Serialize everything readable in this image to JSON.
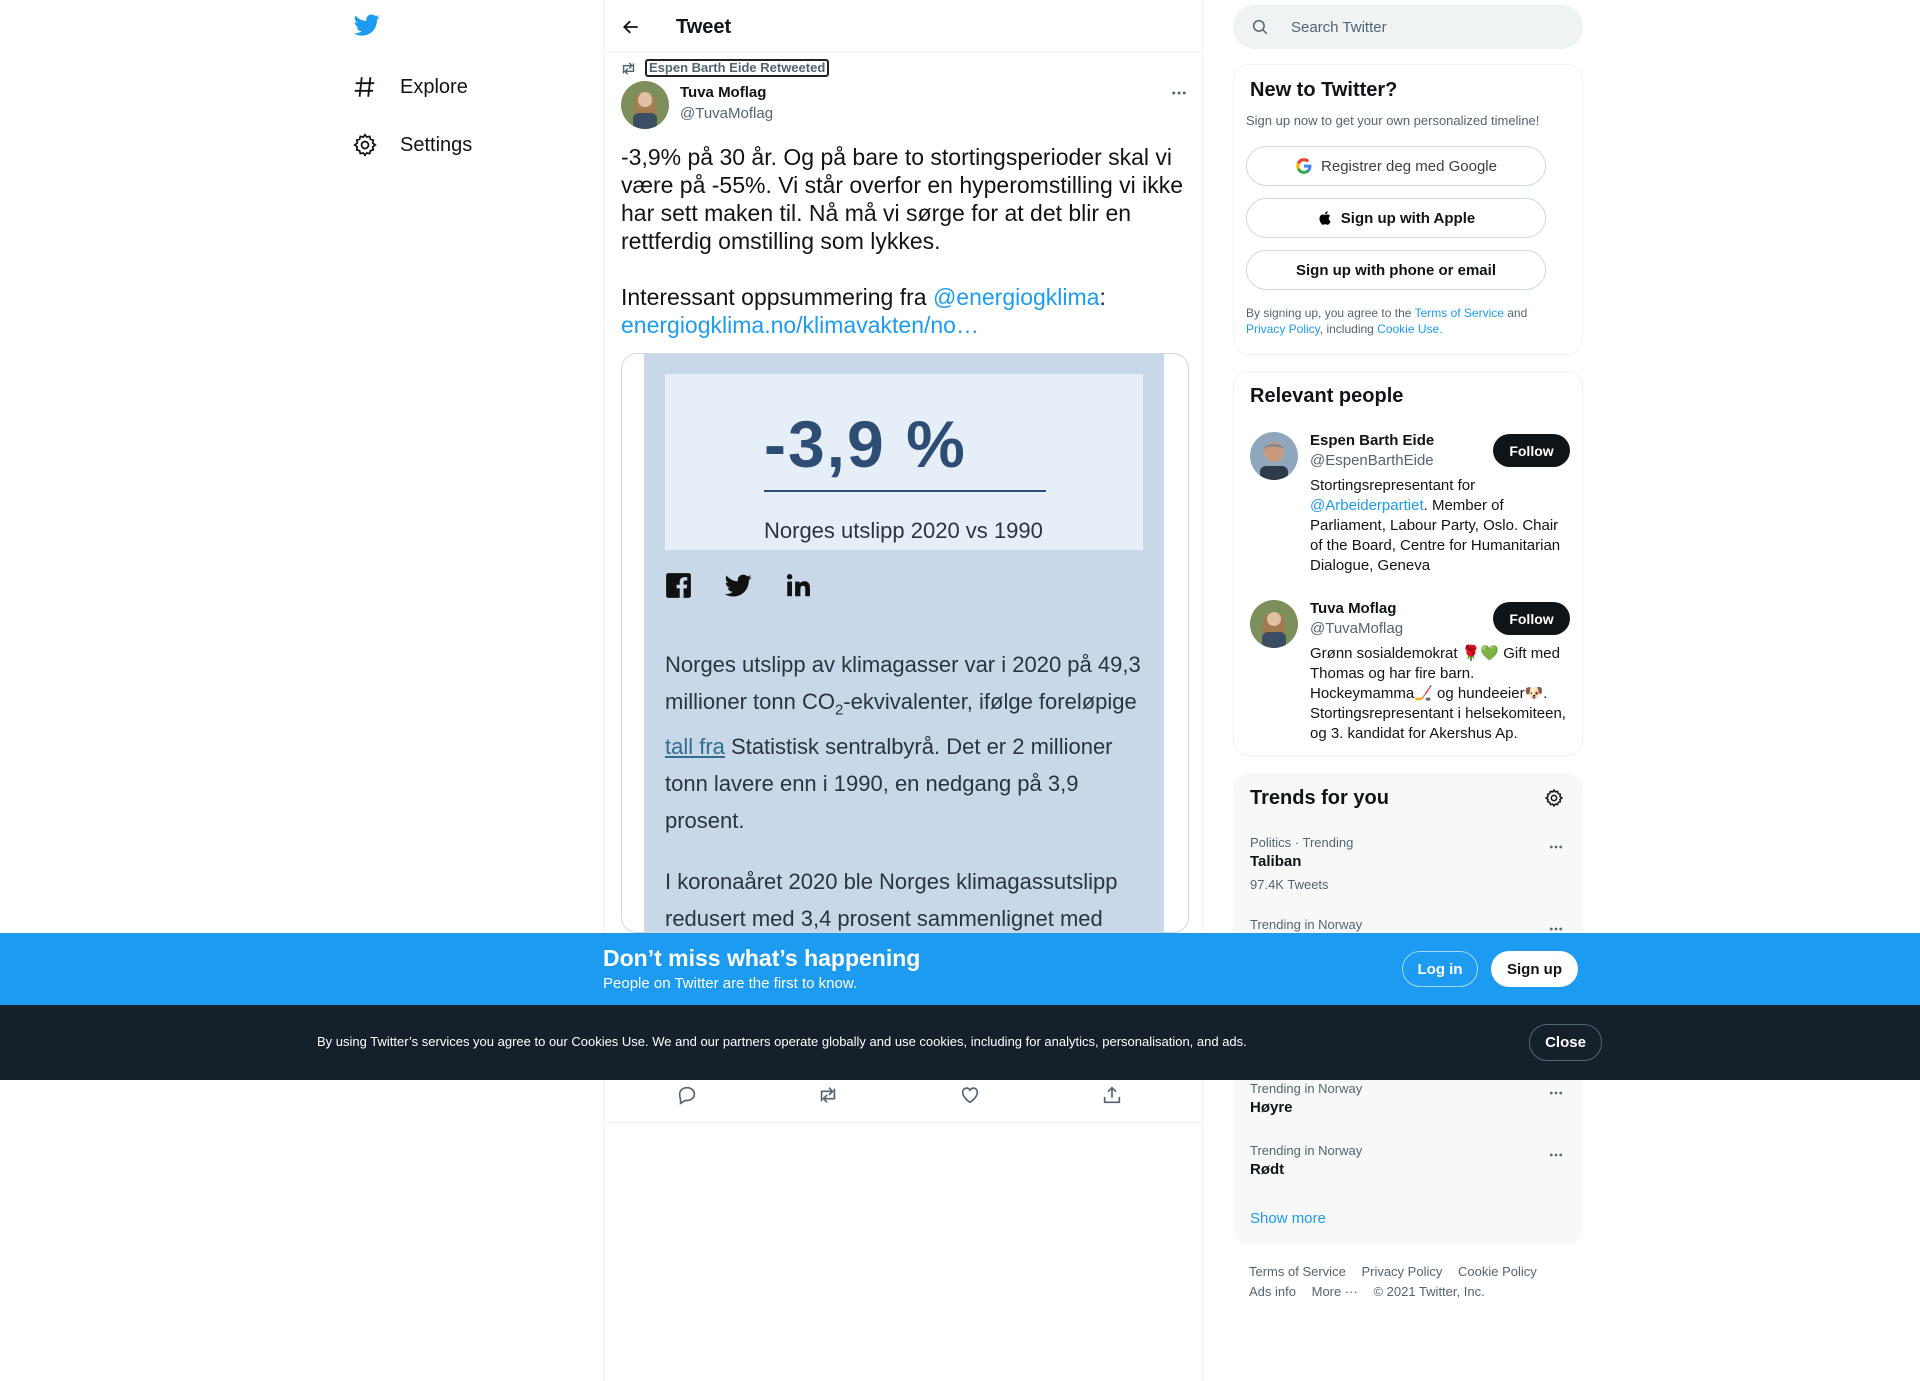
{
  "colors": {
    "accent": "#1d9bf0",
    "text": "#0f1419",
    "muted": "#536471",
    "banner": "#1d9bf0",
    "cookie_bar": "#15202b"
  },
  "nav": {
    "logo_icon": "twitter-bird-icon",
    "items": [
      {
        "label": "Explore",
        "icon": "hash-icon"
      },
      {
        "label": "Settings",
        "icon": "gear-icon"
      }
    ]
  },
  "header": {
    "title": "Tweet",
    "back_icon": "arrow-left-icon"
  },
  "tweet": {
    "retweeted_by": "Espen Barth Eide Retweeted",
    "author_name": "Tuva Moflag",
    "author_handle": "@TuvaMoflag",
    "text_p1": "-3,9% på 30 år. Og på bare to stortingsperioder skal vi være på -55%. Vi står overfor en hyperomstilling vi ikke har sett maken til. Nå må vi sørge for at det blir en rettferdig omstilling som lykkes.",
    "text_p2_prefix": "Interessant oppsummering fra ",
    "mention": "@energiogklima",
    "text_p2_colon": ":",
    "url": "energiogklima.no/klimavakten/no…",
    "media": {
      "stat_value": "-3,9  %",
      "stat_caption": "Norges utslipp 2020 vs 1990",
      "share_icons": [
        "facebook-icon",
        "twitter-icon",
        "linkedin-icon"
      ],
      "para1_a": "Norges utslipp av klimagasser var i 2020 på 49,3 millioner tonn CO",
      "para1_sub": "2",
      "para1_b": "-ekvivalenter, ifølge foreløpige ",
      "para1_link": "tall fra",
      "para1_c": " Statistisk sentralbyrå. Det er 2 millioner tonn lavere enn i 1990, en nedgang på 3,9 prosent.",
      "para2": "I koronaåret 2020 ble Norges klimagassutslipp redusert med 3,4 prosent sammenlignet med"
    },
    "actions": [
      "reply-icon",
      "retweet-icon",
      "like-icon",
      "share-icon"
    ]
  },
  "search": {
    "placeholder": "Search Twitter"
  },
  "new_to_twitter": {
    "title": "New to Twitter?",
    "subtitle": "Sign up now to get your own personalized timeline!",
    "google_btn": "Registrer deg med Google",
    "apple_btn": "Sign up with Apple",
    "phone_btn": "Sign up with phone or email",
    "legal_a": "By signing up, you agree to the ",
    "terms": "Terms of Service",
    "legal_b": " and ",
    "privacy": "Privacy Policy",
    "legal_c": ", including ",
    "cookie": "Cookie Use",
    "legal_d": "."
  },
  "relevant": {
    "title": "Relevant people",
    "follow_label": "Follow",
    "people": [
      {
        "name": "Espen Barth Eide",
        "handle": "@EspenBarthEide",
        "bio_a": "Stortingsrepresentant for ",
        "bio_mention": "@Arbeiderpartiet",
        "bio_b": ". Member of Parliament, Labour Party, Oslo. Chair of the Board, Centre for Humanitarian Dialogue, Geneva"
      },
      {
        "name": "Tuva Moflag",
        "handle": "@TuvaMoflag",
        "bio_a": "Grønn sosialdemokrat 🌹💚 Gift med Thomas og har fire barn. Hockeymamma🏒 og hundeeier🐶. Stortingsrepresentant i helsekomiteen, og 3. kandidat for Akershus Ap.",
        "bio_mention": "",
        "bio_b": ""
      }
    ]
  },
  "trends": {
    "title": "Trends for you",
    "items": [
      {
        "context": "Politics · Trending",
        "name": "Taliban",
        "count": "97.4K Tweets"
      },
      {
        "context": "Trending in Norway",
        "name": "",
        "count": ""
      },
      {
        "context": "Trending in Norway",
        "name": "Høyre",
        "count": ""
      },
      {
        "context": "Trending in Norway",
        "name": "Rødt",
        "count": ""
      }
    ],
    "show_more": "Show more"
  },
  "footer": {
    "links": [
      "Terms of Service",
      "Privacy Policy",
      "Cookie Policy",
      "Ads info",
      "More ···"
    ],
    "copyright": "© 2021 Twitter, Inc."
  },
  "banner": {
    "title": "Don’t miss what’s happening",
    "subtitle": "People on Twitter are the first to know.",
    "login": "Log in",
    "signup": "Sign up"
  },
  "cookie_bar": {
    "text": "By using Twitter’s services you agree to our Cookies Use. We and our partners operate globally and use cookies, including for analytics, personalisation, and ads.",
    "close": "Close"
  }
}
